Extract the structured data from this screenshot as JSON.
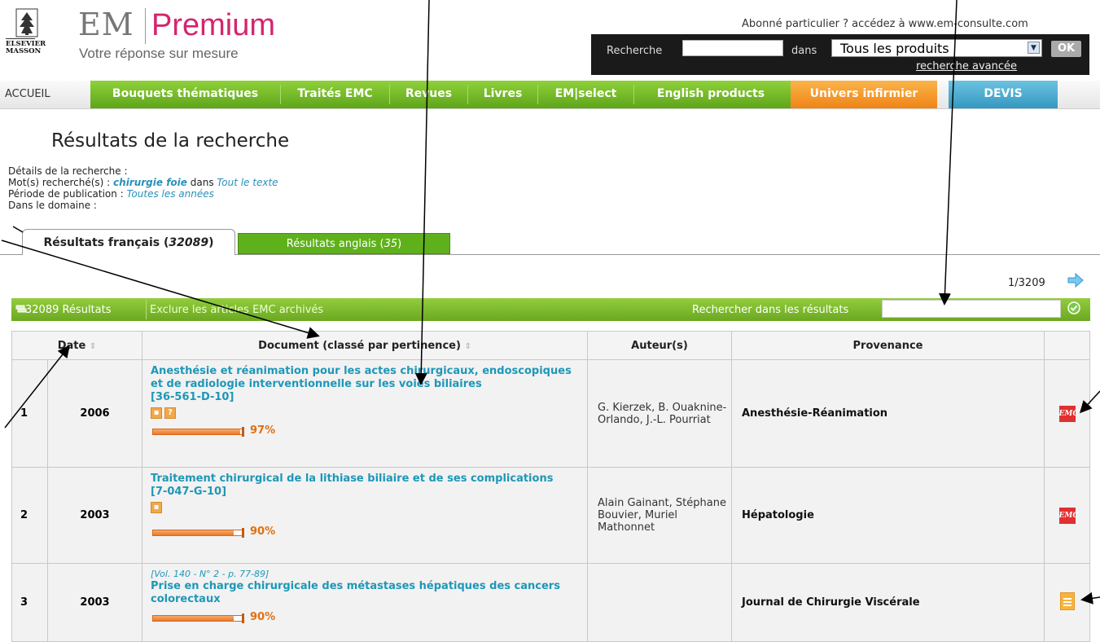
{
  "header": {
    "logo_publisher_line1": "ELSEVIER",
    "logo_publisher_line2": "MASSON",
    "logo_em": "EM",
    "logo_premium": "Premium",
    "tagline": "Votre réponse sur mesure",
    "subscriber_link": "Abonné particulier ? accédez à www.em-consulte.com",
    "search_label": "Recherche",
    "search_value": "",
    "dans_label": "dans",
    "product_selected": "Tous les produits",
    "ok_label": "OK",
    "advanced_search": "recherche avancée"
  },
  "nav": {
    "items": [
      "ACCUEIL",
      "Bouquets thématiques",
      "Traités EMC",
      "Revues",
      "Livres",
      "EM|select",
      "English products",
      "Univers infirmier",
      "DEVIS"
    ]
  },
  "page_title": "Résultats de la recherche",
  "details": {
    "heading": "Détails de la recherche :",
    "keywords_label": "Mot(s) recherché(s) :",
    "keywords": "chirurgie foie",
    "keywords_in": "dans",
    "scope": "Tout le texte",
    "period_label": "Période de publication :",
    "period": "Toutes les années",
    "domain_label": "Dans le domaine :"
  },
  "tabs": {
    "fr_label": "Résultats français (",
    "fr_count": "32089",
    "en_label": "Résultats anglais (",
    "en_count": "35",
    "close": ")"
  },
  "pager": "1/3209",
  "results_bar": {
    "count": "32089 Résultats",
    "exclude": "Exclure les articles EMC archivés",
    "search_in_results": "Rechercher dans les résultats"
  },
  "table": {
    "headers": [
      "Date",
      "Document (classé par pertinence)",
      "Auteur(s)",
      "Provenance"
    ],
    "rows": [
      {
        "num": "1",
        "date": "2006",
        "vol": "",
        "title": "Anesthésie et réanimation pour les actes chirurgicaux, endoscopiques et de radiologie interventionnelle sur les voies biliaires",
        "ref": "[36-561-D-10]",
        "relevance": 97,
        "relevance_text": "97%",
        "authors": "G. Kierzek, B. Ouaknine-Orlando, J.-L. Pourriat",
        "source": "Anesthésie-Réanimation",
        "icon": "emc-icon"
      },
      {
        "num": "2",
        "date": "2003",
        "vol": "",
        "title": "Traitement chirurgical de la lithiase biliaire et de ses complications",
        "ref": "[7-047-G-10]",
        "relevance": 90,
        "relevance_text": "90%",
        "authors": "Alain Gainant, Stéphane Bouvier, Muriel Mathonnet",
        "source": "Hépatologie",
        "icon": "emc-icon"
      },
      {
        "num": "3",
        "date": "2003",
        "vol": "[Vol. 140 - N° 2 - p. 77-89]",
        "title": "Prise en charge chirurgicale des métastases hépatiques des cancers colorectaux",
        "ref": "",
        "relevance": 90,
        "relevance_text": "90%",
        "authors": "",
        "source": "Journal de Chirurgie Viscérale",
        "icon": "journal-icon"
      }
    ]
  },
  "icon_label_emc": "EMC",
  "colors": {
    "brand_pink": "#d6246e",
    "nav_green": "#6aa820",
    "nav_orange": "#f08a1c",
    "nav_blue": "#3aa0c8",
    "link_blue": "#1e97b8",
    "relevance_orange": "#e07010"
  }
}
